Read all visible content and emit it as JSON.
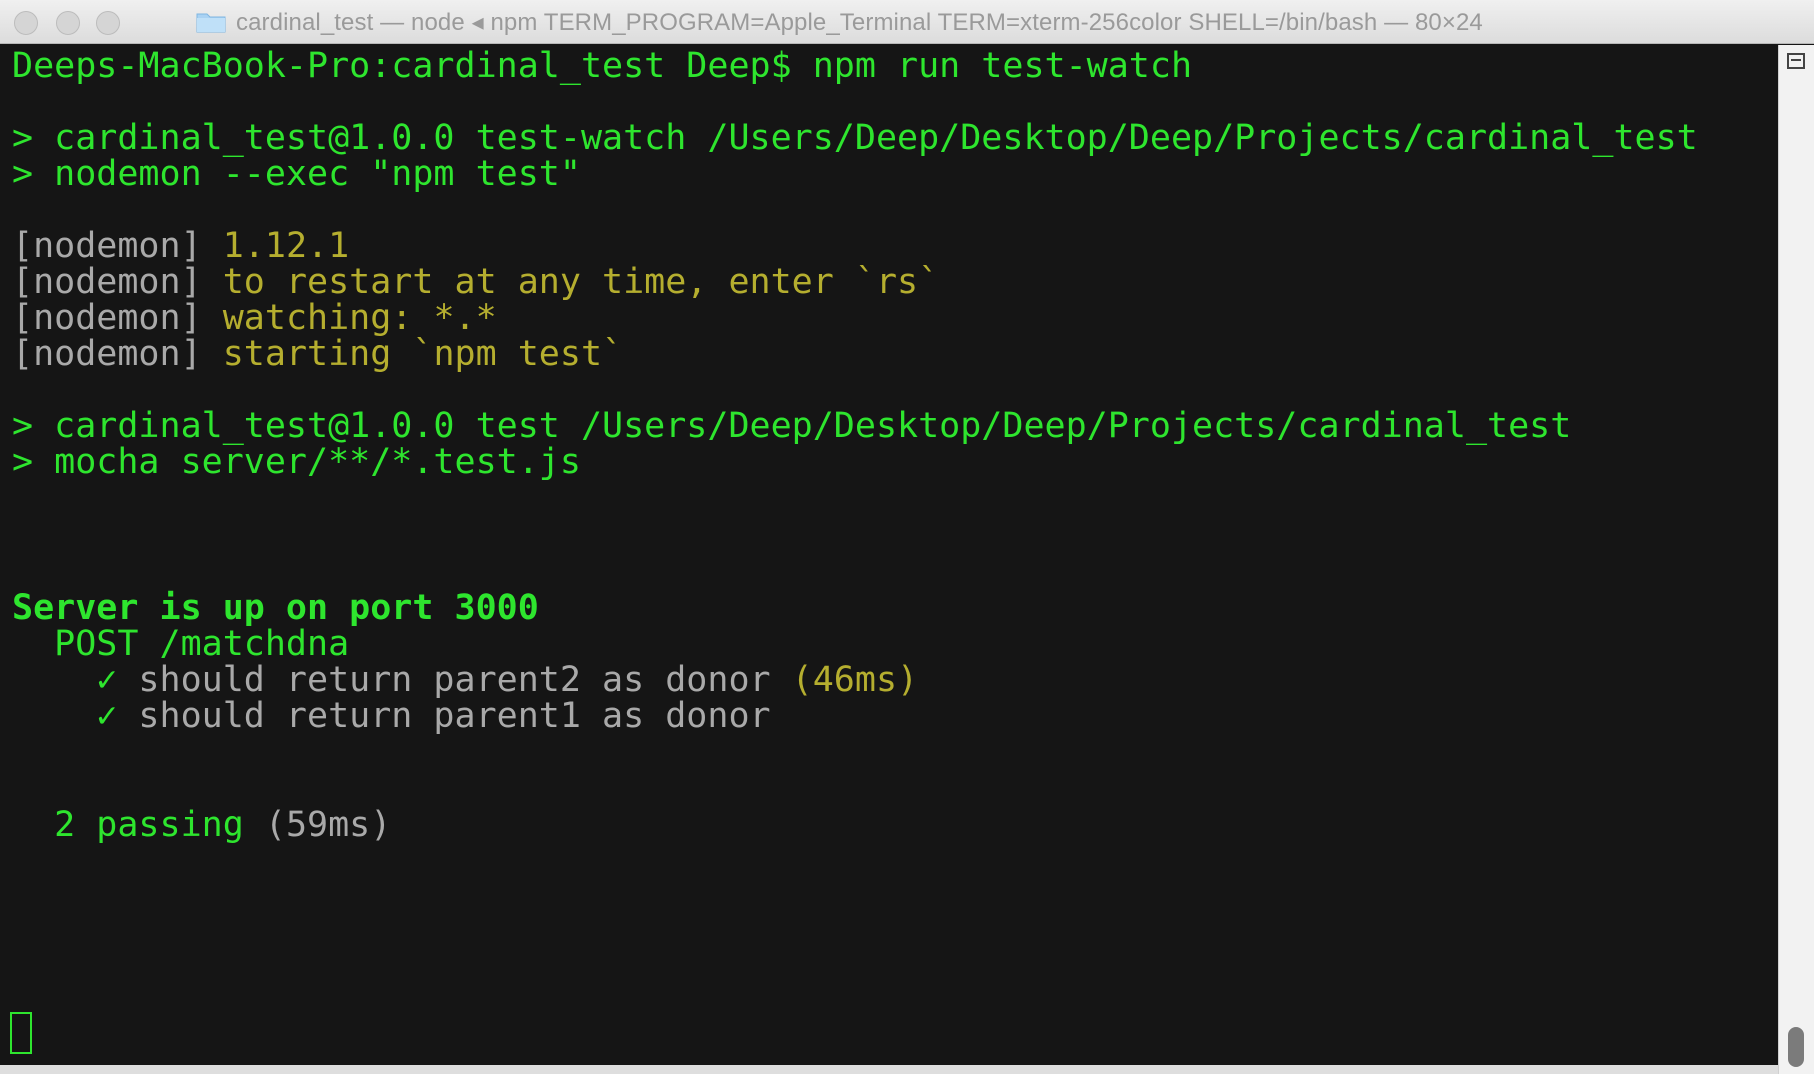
{
  "window": {
    "title": "cardinal_test — node ◂ npm TERM_PROGRAM=Apple_Terminal TERM=xterm-256color SHELL=/bin/bash — 80×24"
  },
  "terminal": {
    "prompt": "Deeps-MacBook-Pro:cardinal_test Deep$ npm run test-watch",
    "script1_line1": "> cardinal_test@1.0.0 test-watch /Users/Deep/Desktop/Deep/Projects/cardinal_test",
    "script1_line2": "> nodemon --exec \"npm test\"",
    "nodemon_tag": "[nodemon]",
    "nodemon_1": " 1.12.1",
    "nodemon_2": " to restart at any time, enter `rs`",
    "nodemon_3": " watching: *.*",
    "nodemon_4": " starting `npm test`",
    "script2_line1": "> cardinal_test@1.0.0 test /Users/Deep/Desktop/Deep/Projects/cardinal_test",
    "script2_line2": "> mocha server/**/*.test.js",
    "server_msg": "Server is up on port 3000",
    "suite": "  POST /matchdna",
    "check": "    ✓",
    "test1": " should return parent2 as donor",
    "test1_time": " (46ms)",
    "test2": " should return parent1 as donor",
    "passing": "  2 passing",
    "passing_time": " (59ms)"
  },
  "colors": {
    "terminal_bg": "#151515",
    "green": "#2ee52e",
    "olive": "#b5ae2f",
    "grey": "#a9a9a9"
  },
  "icons": [
    "folder-icon",
    "split-pane-icon"
  ]
}
